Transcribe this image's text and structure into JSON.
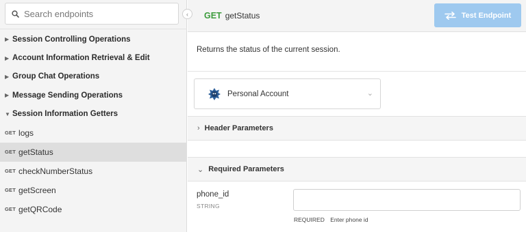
{
  "sidebar": {
    "search_placeholder": "Search endpoints",
    "groups_top": [
      {
        "label": "Session Controlling Operations",
        "caret": "▶"
      },
      {
        "label": "Account Information Retrieval & Edit",
        "caret": "▶"
      },
      {
        "label": "Group Chat Operations",
        "caret": "▶"
      },
      {
        "label": "Message Sending Operations",
        "caret": "▶"
      },
      {
        "label": "Session Information Getters",
        "caret": "▼"
      }
    ],
    "endpoints": [
      {
        "method": "GET",
        "name": "logs"
      },
      {
        "method": "GET",
        "name": "getStatus",
        "active": true
      },
      {
        "method": "GET",
        "name": "checkNumberStatus"
      },
      {
        "method": "GET",
        "name": "getScreen"
      },
      {
        "method": "GET",
        "name": "getQRCode"
      }
    ]
  },
  "topbar": {
    "method": "GET",
    "endpoint": "getStatus",
    "test_button": "Test Endpoint"
  },
  "description": "Returns the status of the current session.",
  "account": {
    "label": "Personal Account",
    "icon": "account-avatar-icon"
  },
  "sections": {
    "header": {
      "label": "Header Parameters",
      "caret": "›"
    },
    "required": {
      "label": "Required Parameters",
      "caret": "⌄"
    }
  },
  "param": {
    "name": "phone_id",
    "type": "STRING",
    "required": "REQUIRED",
    "hint": "Enter phone id",
    "value": ""
  },
  "colors": {
    "method_green": "#3c9b3c",
    "button_blue": "#9ec9ef",
    "sidebar_bg": "#f4f4f4",
    "active_row": "#dedede"
  }
}
